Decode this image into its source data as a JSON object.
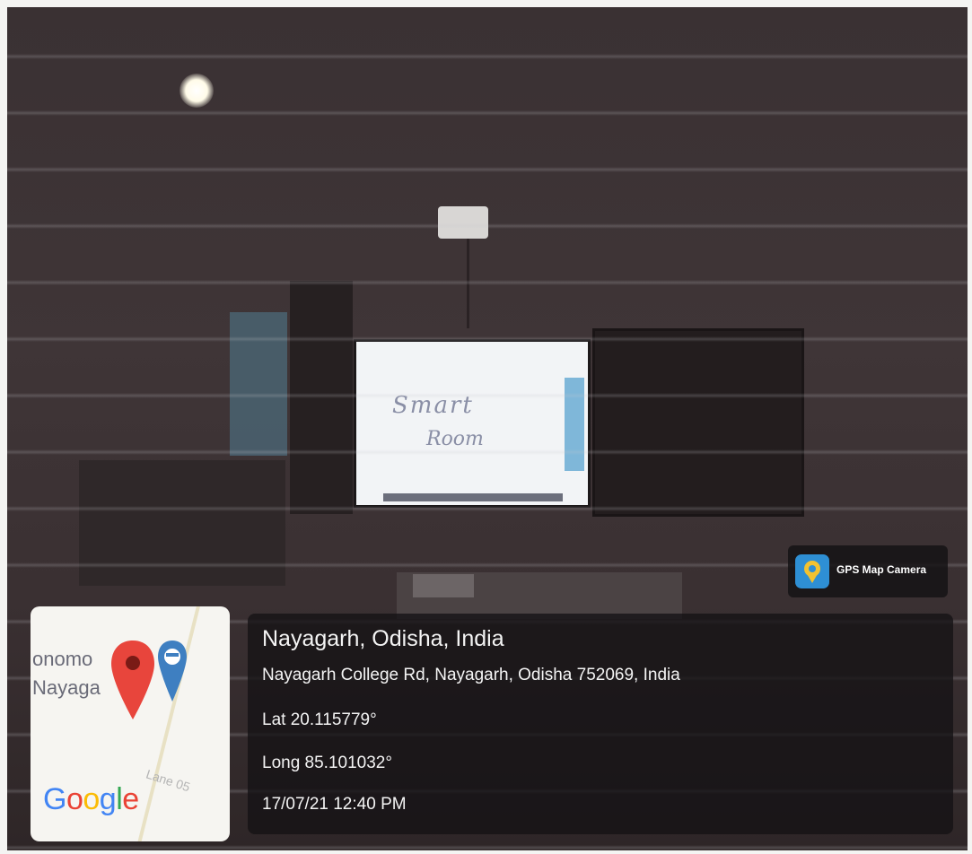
{
  "overlay": {
    "location_title": "Nayagarh, Odisha, India",
    "address": "Nayagarh College Rd, Nayagarh, Odisha 752069, India",
    "latitude": "Lat 20.115779°",
    "longitude": "Long 85.101032°",
    "datetime": "17/07/21 12:40 PM"
  },
  "badge": {
    "app_name": "GPS Map Camera",
    "icon": "map-pin-icon"
  },
  "map": {
    "label_1": "onomo",
    "label_2": "Nayaga",
    "road_label": "Lane 05",
    "logo_text": "Google",
    "pin_color": "#e8453c",
    "secondary_pin_color": "#3e7fc1"
  },
  "scene": {
    "board_text_1": "Smart",
    "board_text_2": "Room"
  }
}
